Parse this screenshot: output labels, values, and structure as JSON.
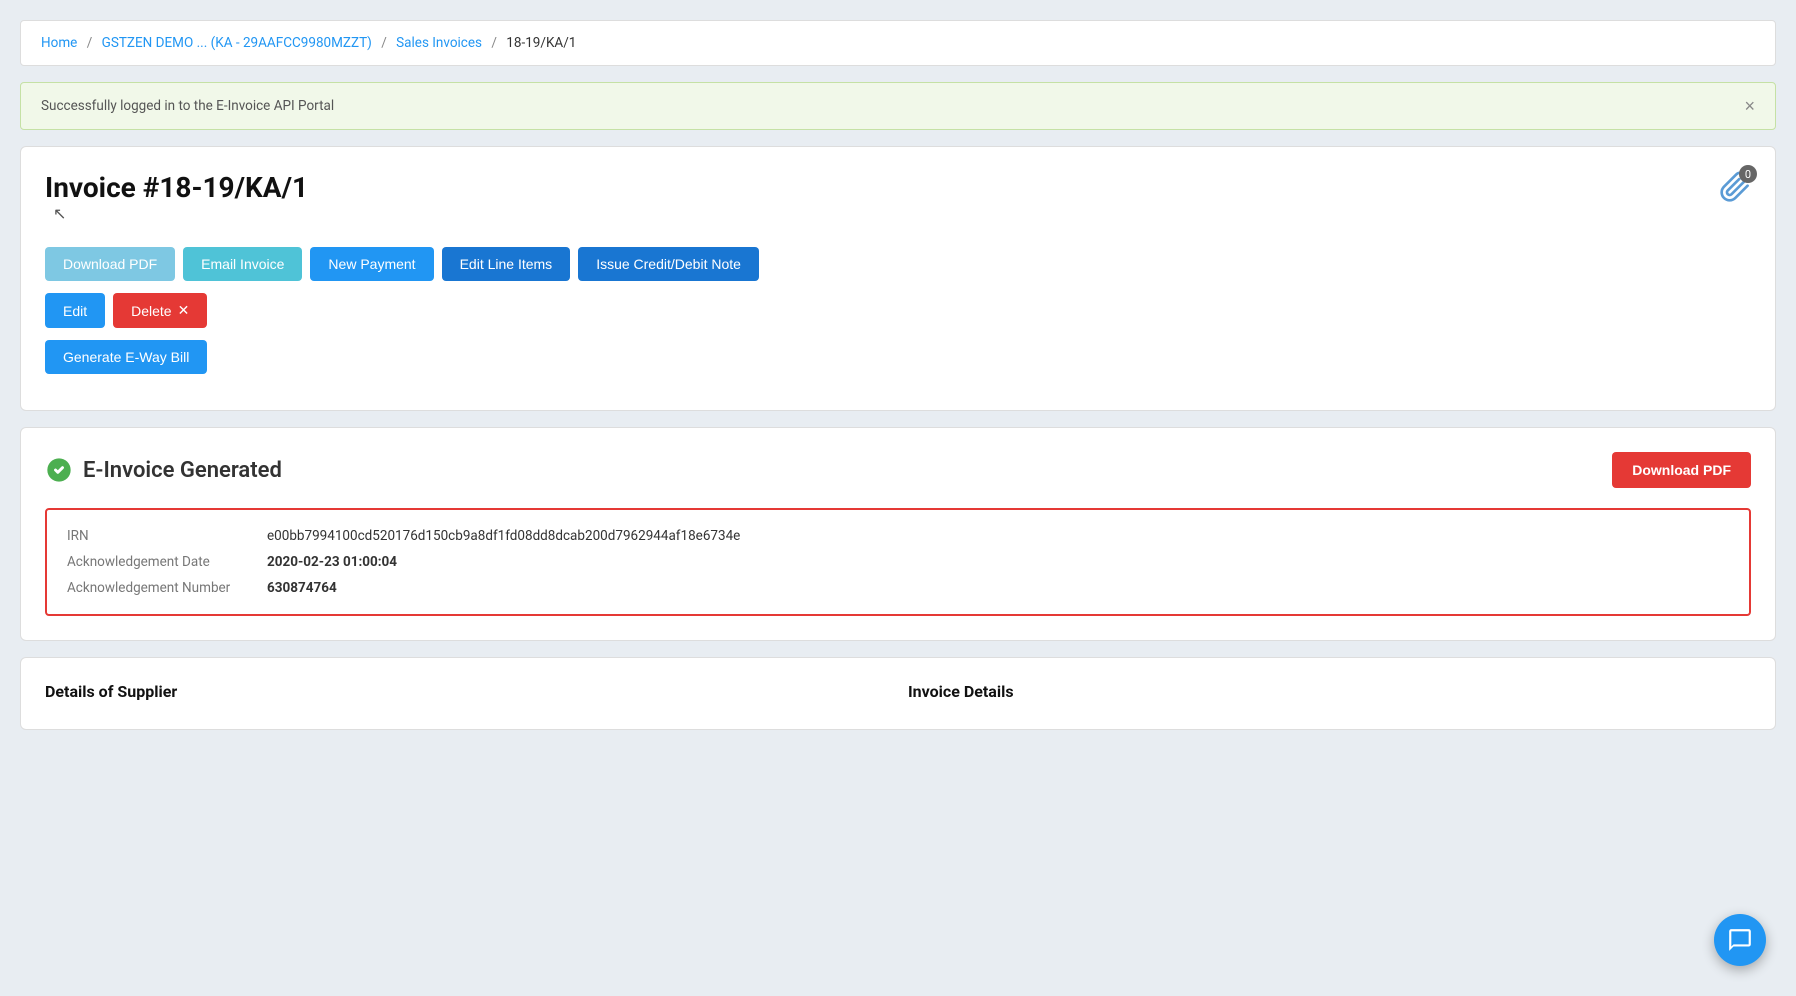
{
  "breadcrumb": {
    "home": "Home",
    "company": "GSTZEN DEMO ... (KA - 29AAFCC9980MZZT)",
    "section": "Sales Invoices",
    "current": "18-19/KA/1"
  },
  "alert": {
    "message": "Successfully logged in to the E-Invoice API Portal",
    "close_label": "×"
  },
  "invoice": {
    "title": "Invoice #18-19/KA/1",
    "attachment_count": "0",
    "buttons": {
      "download_pdf": "Download PDF",
      "email_invoice": "Email Invoice",
      "new_payment": "New Payment",
      "edit_line_items": "Edit Line Items",
      "issue_credit_debit_note": "Issue Credit/Debit Note",
      "edit": "Edit",
      "delete": "Delete",
      "delete_icon": "✕",
      "generate_eway_bill": "Generate E-Way Bill"
    }
  },
  "einvoice": {
    "title": "E-Invoice Generated",
    "download_pdf_label": "Download PDF",
    "irn_label": "IRN",
    "irn_value": "e00bb7994100cd520176d150cb9a8df1fd08dd8dcab200d7962944af18e6734e",
    "ack_date_label": "Acknowledgement Date",
    "ack_date_value": "2020-02-23 01:00:04",
    "ack_number_label": "Acknowledgement Number",
    "ack_number_value": "630874764"
  },
  "details": {
    "supplier_heading": "Details of Supplier",
    "invoice_heading": "Invoice Details"
  },
  "chat": {
    "label": "chat"
  }
}
